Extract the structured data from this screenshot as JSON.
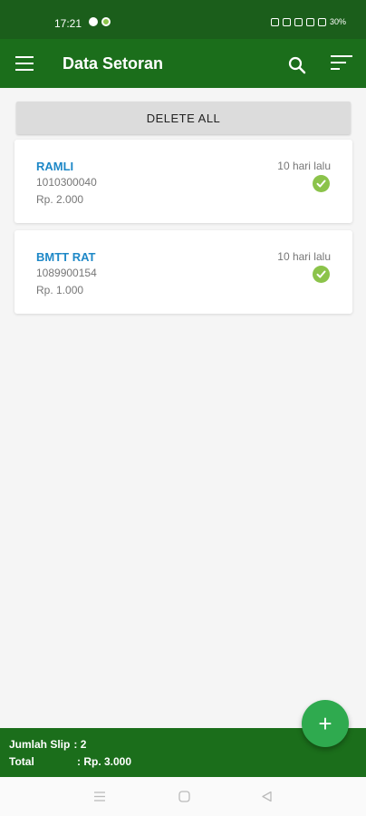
{
  "status_bar": {
    "time": "17:21",
    "battery": "30%"
  },
  "app_bar": {
    "title": "Data Setoran"
  },
  "actions": {
    "delete_all_label": "DELETE ALL"
  },
  "deposits": [
    {
      "name": "RAMLI",
      "account": "1010300040",
      "amount": "Rp. 2.000",
      "time": "10 hari lalu",
      "status": "check-circle-icon"
    },
    {
      "name": "BMTT RAT",
      "account": "1089900154",
      "amount": "Rp. 1.000",
      "time": "10 hari lalu",
      "status": "check-circle-icon"
    }
  ],
  "footer": {
    "slip_label": "Jumlah Slip",
    "slip_value": ": 2",
    "total_label": "Total",
    "total_value": ": Rp. 3.000"
  },
  "fab": {
    "icon": "plus-icon",
    "glyph": "+"
  },
  "colors": {
    "primary": "#1b6e1b",
    "status_bar": "#1b5e1b",
    "accent": "#2faa4f",
    "name_link": "#1e88c7",
    "check": "#8bc34a"
  }
}
